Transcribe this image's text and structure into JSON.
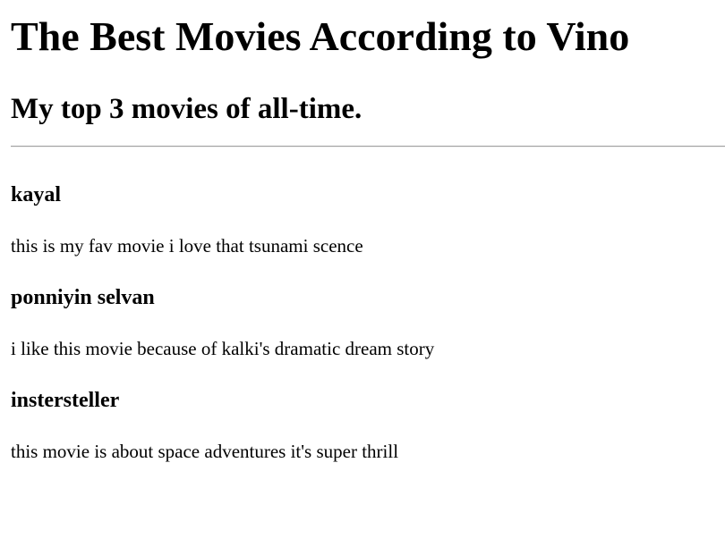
{
  "title": "The Best Movies According to Vino",
  "subtitle": "My top 3 movies of all-time.",
  "movies": [
    {
      "name": "kayal",
      "description": "this is my fav movie i love that tsunami scence"
    },
    {
      "name": "ponniyin selvan",
      "description": "i like this movie because of kalki's dramatic dream story"
    },
    {
      "name": "instersteller",
      "description": "this movie is about space adventures it's super thrill"
    }
  ]
}
